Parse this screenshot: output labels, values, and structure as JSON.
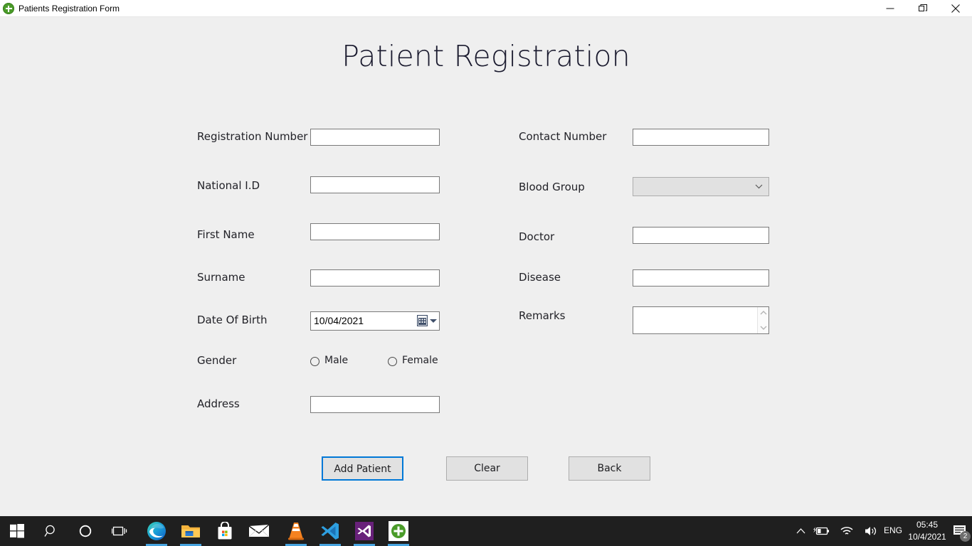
{
  "window": {
    "title": "Patients Registration Form",
    "app_icon": "green-plus-icon",
    "minimize_label": "Minimize",
    "maximize_label": "Restore",
    "close_label": "Close"
  },
  "page": {
    "heading": "Patient Registration"
  },
  "colors": {
    "form_background": "#EFEFEF",
    "titlebar_background": "#FFFFFF",
    "focus_accent": "#0078D7",
    "taskbar_background": "#1F1F1F",
    "taskbar_active_indicator": "#47A4E0",
    "app_icon_green": "#4A9B29",
    "input_border": "#7A7A7A",
    "combobox_fill": "#E1E1E1"
  },
  "form": {
    "left_column": [
      {
        "label": "Registration Number",
        "type": "textbox",
        "value": "",
        "placeholder": ""
      },
      {
        "label": "National I.D",
        "type": "textbox",
        "value": "",
        "placeholder": ""
      },
      {
        "label": "First Name",
        "type": "textbox",
        "value": "",
        "placeholder": ""
      },
      {
        "label": "Surname",
        "type": "textbox",
        "value": "",
        "placeholder": ""
      },
      {
        "label": "Date Of Birth",
        "type": "datepicker",
        "value": "10/04/2021"
      },
      {
        "label": "Gender",
        "type": "radiogroup"
      },
      {
        "label": "Address",
        "type": "textbox",
        "value": "",
        "placeholder": ""
      }
    ],
    "right_column": [
      {
        "label": "Contact Number",
        "type": "textbox",
        "value": "",
        "placeholder": ""
      },
      {
        "label": "Blood Group",
        "type": "combobox",
        "value": "",
        "selected": ""
      },
      {
        "label": "Doctor",
        "type": "textbox",
        "value": "",
        "placeholder": ""
      },
      {
        "label": "Disease",
        "type": "textbox",
        "value": "",
        "placeholder": ""
      },
      {
        "label": "Remarks",
        "type": "textarea",
        "value": "",
        "placeholder": ""
      }
    ],
    "gender": {
      "label": "Gender",
      "options": [
        {
          "label": "Male",
          "selected": false
        },
        {
          "label": "Female",
          "selected": false
        }
      ]
    },
    "buttons": [
      {
        "label": "Add Patient",
        "focused": true
      },
      {
        "label": "Clear",
        "focused": false
      },
      {
        "label": "Back",
        "focused": false
      }
    ]
  },
  "taskbar": {
    "items": [
      {
        "name": "start-button",
        "icon": "windows-logo-icon",
        "active": false
      },
      {
        "name": "search-button",
        "icon": "search-icon",
        "active": false
      },
      {
        "name": "cortana-button",
        "icon": "cortana-circle-icon",
        "active": false
      },
      {
        "name": "task-view-button",
        "icon": "task-view-icon",
        "active": false
      },
      {
        "name": "edge-button",
        "icon": "edge-icon",
        "active": true
      },
      {
        "name": "file-explorer-button",
        "icon": "folder-icon",
        "active": true
      },
      {
        "name": "microsoft-store-button",
        "icon": "store-bag-icon",
        "active": false
      },
      {
        "name": "mail-button",
        "icon": "mail-envelope-icon",
        "active": false
      },
      {
        "name": "vlc-button",
        "icon": "vlc-cone-icon",
        "active": true
      },
      {
        "name": "vscode-button",
        "icon": "vscode-icon",
        "active": true
      },
      {
        "name": "visual-studio-button",
        "icon": "visual-studio-icon",
        "active": true
      },
      {
        "name": "patients-app-button",
        "icon": "green-plus-icon",
        "active": true
      }
    ],
    "tray": {
      "show_hidden_label": "Show hidden icons",
      "battery": "battery-charging-icon",
      "network": "wifi-icon",
      "volume": "speaker-icon",
      "language": "ENG",
      "time": "05:45",
      "date": "10/4/2021",
      "notifications_icon": "notification-center-icon",
      "notifications_count": "2"
    }
  }
}
